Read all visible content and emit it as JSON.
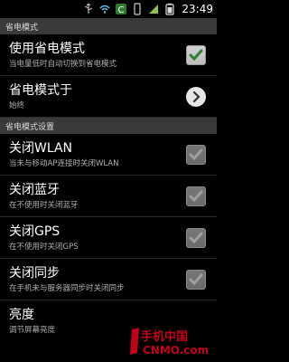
{
  "status": {
    "time": "23:49"
  },
  "sections": {
    "power_mode": "省电模式",
    "power_settings": "省电模式设置"
  },
  "items": {
    "use_power_saving": {
      "title": "使用省电模式",
      "summary": "当电量低时自动切换到省电模式",
      "checked": true
    },
    "power_mode_when": {
      "title": "省电模式于",
      "summary": "始终"
    },
    "wlan": {
      "title": "关闭WLAN",
      "summary": "当未与移动AP连接时关闭WLAN",
      "checked": true,
      "enabled": false
    },
    "bluetooth": {
      "title": "关闭蓝牙",
      "summary": "在不使用时关闭蓝牙",
      "checked": true,
      "enabled": false
    },
    "gps": {
      "title": "关闭GPS",
      "summary": "在不使用时关闭GPS",
      "checked": true,
      "enabled": false
    },
    "sync": {
      "title": "关闭同步",
      "summary": "在手机未与服务器同步时关闭同步",
      "checked": true,
      "enabled": false
    },
    "brightness": {
      "title": "亮度",
      "summary": "调节屏幕亮度"
    }
  },
  "watermark": {
    "line1": "手机中国",
    "line2": "CNMO.com",
    "color": "#c2001a"
  }
}
